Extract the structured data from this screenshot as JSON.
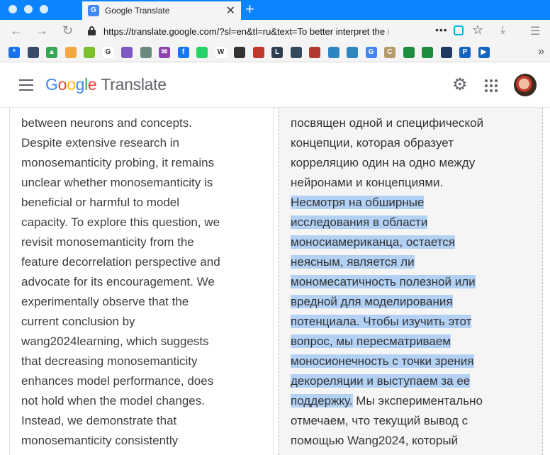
{
  "browser": {
    "tab": {
      "title": "Google Translate",
      "favicon_text": "G"
    },
    "url_visible": "https://translate.google.com/?sl=en&tl=ru&text=To better interpret the ",
    "url_faded": "i",
    "icons": [
      "back-icon",
      "forward-icon",
      "reload-icon",
      "lock-icon",
      "more-icon",
      "pocket-icon",
      "star-icon",
      "download-icon",
      "menu-icon"
    ]
  },
  "bookmarks": [
    {
      "name": "asterisk-bookmark-icon",
      "color": "#1a73e8",
      "glyph": "*"
    },
    {
      "name": "photo-bookmark-icon",
      "color": "#3a4a6a",
      "glyph": ""
    },
    {
      "name": "drive-bookmark-icon",
      "color": "#34a853",
      "glyph": "▲"
    },
    {
      "name": "rainbow-bookmark-icon",
      "color": "#f4a640",
      "glyph": ""
    },
    {
      "name": "green-dot-bookmark-icon",
      "color": "#7cc12b",
      "glyph": ""
    },
    {
      "name": "google-bookmark-icon",
      "color": "#ffffff",
      "glyph": "G"
    },
    {
      "name": "puzzle-bookmark-icon",
      "color": "#7e57c2",
      "glyph": ""
    },
    {
      "name": "openai-bookmark-icon",
      "color": "#6a8a80",
      "glyph": ""
    },
    {
      "name": "mail-bookmark-icon",
      "color": "#8e44ad",
      "glyph": "✉"
    },
    {
      "name": "facebook-bookmark-icon",
      "color": "#1877f2",
      "glyph": "f"
    },
    {
      "name": "whatsapp-bookmark-icon",
      "color": "#25d366",
      "glyph": ""
    },
    {
      "name": "wikipedia-bookmark-icon",
      "color": "#ffffff",
      "glyph": "W"
    },
    {
      "name": "book-bookmark-icon",
      "color": "#333333",
      "glyph": ""
    },
    {
      "name": "mosaic-bookmark-icon",
      "color": "#c0392b",
      "glyph": ""
    },
    {
      "name": "letter-l-bookmark-icon",
      "color": "#2c3e50",
      "glyph": "L"
    },
    {
      "name": "hex-bookmark-icon",
      "color": "#34495e",
      "glyph": ""
    },
    {
      "name": "grid-bookmark-icon",
      "color": "#b03a2e",
      "glyph": ""
    },
    {
      "name": "disc-bookmark-icon",
      "color": "#2e86c1",
      "glyph": ""
    },
    {
      "name": "disc2-bookmark-icon",
      "color": "#2e86c1",
      "glyph": ""
    },
    {
      "name": "translate-bookmark-icon",
      "color": "#4285f4",
      "glyph": "G"
    },
    {
      "name": "c-bookmark-icon",
      "color": "#b59a6a",
      "glyph": "C"
    },
    {
      "name": "flag-bookmark-icon",
      "color": "#1e8e3e",
      "glyph": ""
    },
    {
      "name": "flag2-bookmark-icon",
      "color": "#1e8e3e",
      "glyph": ""
    },
    {
      "name": "open-bookmark-icon",
      "color": "#1f3a60",
      "glyph": ""
    },
    {
      "name": "p-bookmark-icon",
      "color": "#1565c0",
      "glyph": "P"
    },
    {
      "name": "play-bookmark-icon",
      "color": "#1565c0",
      "glyph": "▶"
    }
  ],
  "app": {
    "logo_letters": [
      "G",
      "o",
      "o",
      "g",
      "l",
      "e"
    ],
    "logo_suffix": "Translate"
  },
  "source_lines": [
    "between neurons and concepts.",
    "Despite extensive research in",
    "monosemanticity probing, it remains",
    "unclear whether monosemanticity is",
    "beneficial or harmful to model",
    "capacity. To explore this question, we",
    "revisit monosemanticity from the",
    "feature decorrelation perspective and",
    "advocate for its encouragement. We",
    "experimentally observe that the",
    "current conclusion by",
    "wang2024learning, which suggests",
    "that decreasing monosemanticity",
    "enhances model performance, does",
    "not hold when the model changes.",
    "Instead, we demonstrate that",
    "monosemanticity consistently"
  ],
  "target_lines": [
    {
      "pre": "посвящен одной и специфической",
      "hl": "",
      "post": ""
    },
    {
      "pre": "концепции, которая образует",
      "hl": "",
      "post": ""
    },
    {
      "pre": "корреляцию один на одно между",
      "hl": "",
      "post": ""
    },
    {
      "pre": "нейронами и концепциями.",
      "hl": "",
      "post": ""
    },
    {
      "pre": "",
      "hl": "Несмотря на обширные",
      "post": ""
    },
    {
      "pre": "",
      "hl": "исследования в области",
      "post": ""
    },
    {
      "pre": "",
      "hl": "моносиамериканца, остается",
      "post": ""
    },
    {
      "pre": "",
      "hl": "неясным, является ли",
      "post": ""
    },
    {
      "pre": "",
      "hl": "мономесатичность полезной или",
      "post": ""
    },
    {
      "pre": "",
      "hl": "вредной для моделирования",
      "post": ""
    },
    {
      "pre": "",
      "hl": "потенциала. Чтобы изучить этот",
      "post": ""
    },
    {
      "pre": "",
      "hl": "вопрос, мы пересматриваем",
      "post": ""
    },
    {
      "pre": "",
      "hl": "моносионечность с точки зрения",
      "post": ""
    },
    {
      "pre": "",
      "hl": "декореляции и выступаем за ее",
      "post": ""
    },
    {
      "pre": "",
      "hl": "поддержку.",
      "post": " Мы экспериментально"
    },
    {
      "pre": "отмечаем, что текущий вывод с",
      "hl": "",
      "post": ""
    },
    {
      "pre": "помощью Wang2024, который",
      "hl": "",
      "post": ""
    }
  ]
}
